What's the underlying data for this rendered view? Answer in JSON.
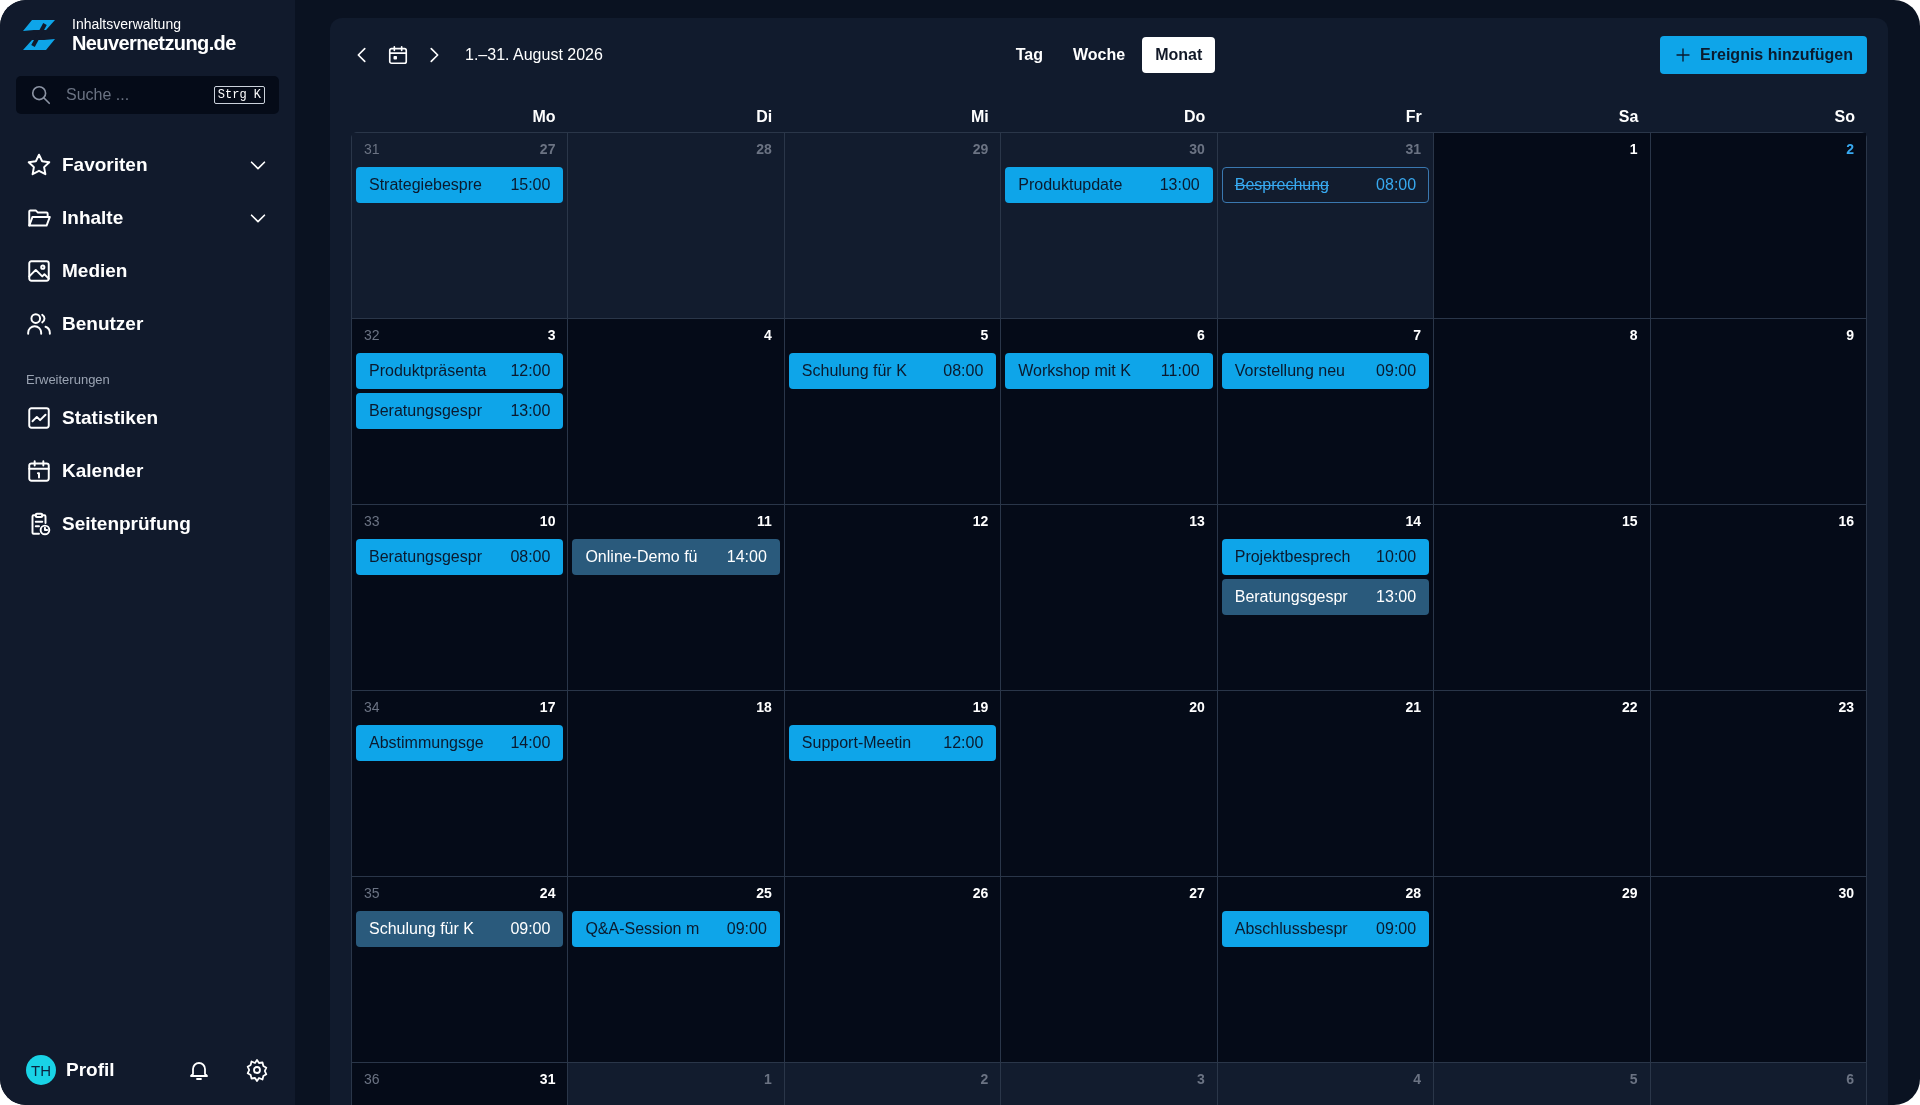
{
  "brand": {
    "subtitle": "Inhaltsverwaltung",
    "name": "Neuvernetzung.de"
  },
  "search": {
    "placeholder": "Suche ...",
    "shortcut": "Strg K"
  },
  "nav": [
    {
      "label": "Favoriten",
      "kind": "group"
    },
    {
      "label": "Inhalte",
      "kind": "group"
    },
    {
      "label": "Medien",
      "kind": "link"
    },
    {
      "label": "Benutzer",
      "kind": "link"
    }
  ],
  "section_label": "Erweiterungen",
  "extensions": [
    {
      "label": "Statistiken"
    },
    {
      "label": "Kalender"
    },
    {
      "label": "Seitenprüfung"
    }
  ],
  "profile": {
    "initials": "TH",
    "label": "Profil"
  },
  "toolbar": {
    "range": "1.–31. August 2026",
    "views": [
      {
        "label": "Tag",
        "selected": false
      },
      {
        "label": "Woche",
        "selected": false
      },
      {
        "label": "Monat",
        "selected": true
      }
    ],
    "add_button": "Ereignis hinzufügen"
  },
  "weekdays": [
    "Mo",
    "Di",
    "Mi",
    "Do",
    "Fr",
    "Sa",
    "So"
  ],
  "weeks": [
    {
      "number": "31",
      "days": [
        {
          "day": "27",
          "in_month": false,
          "today": false,
          "events": [
            {
              "title": "Strategiebespre",
              "time": "15:00",
              "kind": "solid"
            }
          ]
        },
        {
          "day": "28",
          "in_month": false,
          "today": false
        },
        {
          "day": "29",
          "in_month": false,
          "today": false
        },
        {
          "day": "30",
          "in_month": false,
          "today": false,
          "events": [
            {
              "title": "Produktupdate",
              "time": "13:00",
              "kind": "solid"
            }
          ]
        },
        {
          "day": "31",
          "in_month": false,
          "today": false,
          "events": [
            {
              "title": "Besprechung",
              "time": "08:00",
              "kind": "cancelled"
            }
          ]
        },
        {
          "day": "1",
          "in_month": true,
          "today": false
        },
        {
          "day": "2",
          "in_month": true,
          "today": true
        }
      ]
    },
    {
      "number": "32",
      "days": [
        {
          "day": "3",
          "in_month": true,
          "today": false,
          "events": [
            {
              "title": "Produktpräsenta",
              "time": "12:00",
              "kind": "solid"
            },
            {
              "title": "Beratungsgespr",
              "time": "13:00",
              "kind": "solid"
            }
          ]
        },
        {
          "day": "4",
          "in_month": true,
          "today": false
        },
        {
          "day": "5",
          "in_month": true,
          "today": false,
          "events": [
            {
              "title": "Schulung für K",
              "time": "08:00",
              "kind": "solid"
            }
          ]
        },
        {
          "day": "6",
          "in_month": true,
          "today": false,
          "events": [
            {
              "title": "Workshop mit K",
              "time": "11:00",
              "kind": "solid"
            }
          ]
        },
        {
          "day": "7",
          "in_month": true,
          "today": false,
          "events": [
            {
              "title": "Vorstellung neu",
              "time": "09:00",
              "kind": "solid"
            }
          ]
        },
        {
          "day": "8",
          "in_month": true,
          "today": false
        },
        {
          "day": "9",
          "in_month": true,
          "today": false
        }
      ]
    },
    {
      "number": "33",
      "days": [
        {
          "day": "10",
          "in_month": true,
          "today": false,
          "events": [
            {
              "title": "Beratungsgespr",
              "time": "08:00",
              "kind": "solid"
            }
          ]
        },
        {
          "day": "11",
          "in_month": true,
          "today": false,
          "events": [
            {
              "title": "Online-Demo fü",
              "time": "14:00",
              "kind": "muted"
            }
          ]
        },
        {
          "day": "12",
          "in_month": true,
          "today": false
        },
        {
          "day": "13",
          "in_month": true,
          "today": false
        },
        {
          "day": "14",
          "in_month": true,
          "today": false,
          "events": [
            {
              "title": "Projektbesprech",
              "time": "10:00",
              "kind": "solid"
            },
            {
              "title": "Beratungsgespr",
              "time": "13:00",
              "kind": "muted"
            }
          ]
        },
        {
          "day": "15",
          "in_month": true,
          "today": false
        },
        {
          "day": "16",
          "in_month": true,
          "today": false
        }
      ]
    },
    {
      "number": "34",
      "days": [
        {
          "day": "17",
          "in_month": true,
          "today": false,
          "events": [
            {
              "title": "Abstimmungsge",
              "time": "14:00",
              "kind": "solid"
            }
          ]
        },
        {
          "day": "18",
          "in_month": true,
          "today": false
        },
        {
          "day": "19",
          "in_month": true,
          "today": false,
          "events": [
            {
              "title": "Support-Meetin",
              "time": "12:00",
              "kind": "solid"
            }
          ]
        },
        {
          "day": "20",
          "in_month": true,
          "today": false
        },
        {
          "day": "21",
          "in_month": true,
          "today": false
        },
        {
          "day": "22",
          "in_month": true,
          "today": false
        },
        {
          "day": "23",
          "in_month": true,
          "today": false
        }
      ]
    },
    {
      "number": "35",
      "days": [
        {
          "day": "24",
          "in_month": true,
          "today": false,
          "events": [
            {
              "title": "Schulung für K",
              "time": "09:00",
              "kind": "muted"
            }
          ]
        },
        {
          "day": "25",
          "in_month": true,
          "today": false,
          "events": [
            {
              "title": "Q&A-Session m",
              "time": "09:00",
              "kind": "solid"
            }
          ]
        },
        {
          "day": "26",
          "in_month": true,
          "today": false
        },
        {
          "day": "27",
          "in_month": true,
          "today": false
        },
        {
          "day": "28",
          "in_month": true,
          "today": false,
          "events": [
            {
              "title": "Abschlussbespr",
              "time": "09:00",
              "kind": "solid"
            }
          ]
        },
        {
          "day": "29",
          "in_month": true,
          "today": false
        },
        {
          "day": "30",
          "in_month": true,
          "today": false
        }
      ]
    },
    {
      "number": "36",
      "days": [
        {
          "day": "31",
          "in_month": true,
          "today": false
        },
        {
          "day": "1",
          "in_month": false,
          "today": false
        },
        {
          "day": "2",
          "in_month": false,
          "today": false
        },
        {
          "day": "3",
          "in_month": false,
          "today": false
        },
        {
          "day": "4",
          "in_month": false,
          "today": false
        },
        {
          "day": "5",
          "in_month": false,
          "today": false
        },
        {
          "day": "6",
          "in_month": false,
          "today": false
        }
      ]
    }
  ]
}
